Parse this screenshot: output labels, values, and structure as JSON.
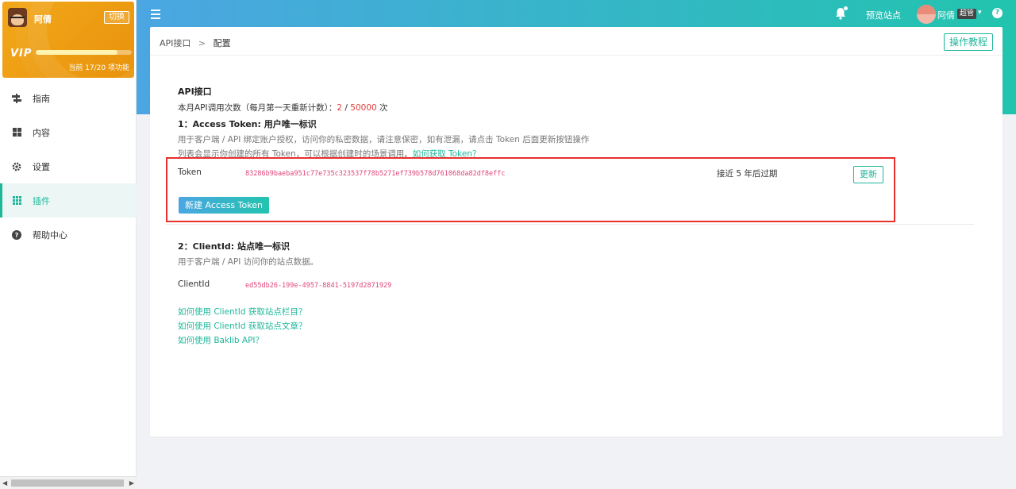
{
  "vip": {
    "user_name": "阿倩",
    "switch_label": "切换",
    "logo": "VIP",
    "progress_text": "当前 17/20 项功能",
    "progress_fraction": 0.85
  },
  "nav": {
    "items": [
      {
        "label": "指南",
        "icon": "signpost-icon"
      },
      {
        "label": "内容",
        "icon": "grid-icon"
      },
      {
        "label": "设置",
        "icon": "gear-icon"
      },
      {
        "label": "插件",
        "icon": "apps-icon",
        "active": true
      },
      {
        "label": "帮助中心",
        "icon": "help-circle-icon"
      }
    ]
  },
  "header": {
    "preview_site": "预览站点",
    "user_name": "阿倩",
    "role_badge": "超管",
    "caret": "▾",
    "help": "?"
  },
  "breadcrumb": {
    "parent": "API接口",
    "separator": ">",
    "current": "配置"
  },
  "tutorial_label": "操作教程",
  "api": {
    "title": "API接口",
    "usage_prefix": "本月API调用次数（每月第一天重新计数）：",
    "used": "2",
    "slash": " / ",
    "limit": "50000",
    "usage_suffix": " 次"
  },
  "access_token": {
    "title": "1：Access Token: 用户唯一标识",
    "desc1": "用于客户端 / API 绑定账户授权，访问你的私密数据，请注意保密，如有泄漏，请点击 Token 后面更新按钮操作",
    "desc2": "列表会显示你创建的所有 Token，可以根据创建时的场景调用。",
    "desc2_link": "如何获取 Token？",
    "label": "Token",
    "value": "83286b9baeba951c77e735c323537f78b5271ef739b578d761068da82df8effc",
    "expiry": "接近 5 年后过期",
    "refresh_label": "更新",
    "new_label": "新建 Access Token"
  },
  "client": {
    "title": "2：ClientId: 站点唯一标识",
    "desc": "用于客户端 / API 访问你的站点数据。",
    "label": "ClientId",
    "value": "ed55db26-199e-4957-8841-5197d2871929",
    "links": [
      "如何使用 ClientId 获取站点栏目？",
      "如何使用 ClientId 获取站点文章？",
      "如何使用 Baklib API？"
    ]
  }
}
